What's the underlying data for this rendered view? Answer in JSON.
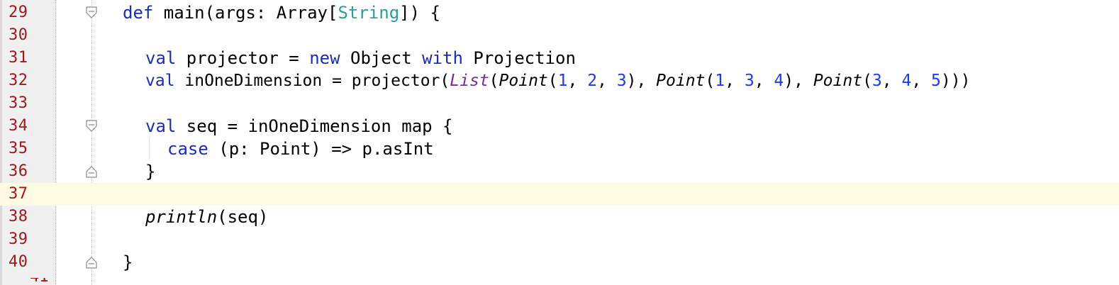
{
  "editor": {
    "current_line_number": "37",
    "lines": [
      {
        "number": "29",
        "text": "def main(args: Array[String]) {"
      },
      {
        "number": "30",
        "text": ""
      },
      {
        "number": "31",
        "text": "val projector = new Object with Projection"
      },
      {
        "number": "32",
        "text": "val inOneDimension = projector(List(Point(1, 2, 3), Point(1, 3, 4), Point(3, 4, 5)))"
      },
      {
        "number": "33",
        "text": ""
      },
      {
        "number": "34",
        "text": "val seq = inOneDimension map {"
      },
      {
        "number": "35",
        "text": "case (p: Point) => p.asInt"
      },
      {
        "number": "36",
        "text": "}"
      },
      {
        "number": "37",
        "text": ""
      },
      {
        "number": "38",
        "text": "println(seq)"
      },
      {
        "number": "39",
        "text": ""
      },
      {
        "number": "40",
        "text": "}"
      }
    ],
    "tokens": {
      "l29": {
        "def": "def",
        "main": " main(args: Array[",
        "String": "String",
        "end": "]) {"
      },
      "l31": {
        "val": "val",
        "a": " projector = ",
        "new": "new",
        "b": " Object ",
        "with": "with",
        "c": " Projection"
      },
      "l32": {
        "val": "val",
        "a": " inOneDimension = projector(",
        "List": "List",
        "p0": "(",
        "Point1": "Point",
        "p1": "(",
        "n1": "1",
        "c1": ", ",
        "n2": "2",
        "c2": ", ",
        "n3": "3",
        "p2": "), ",
        "Point2": "Point",
        "p3": "(",
        "n4": "1",
        "c3": ", ",
        "n5": "3",
        "c4": ", ",
        "n6": "4",
        "p4": "), ",
        "Point3": "Point",
        "p5": "(",
        "n7": "3",
        "c5": ", ",
        "n8": "4",
        "c6": ", ",
        "n9": "5",
        "p6": ")))"
      },
      "l34": {
        "val": "val",
        "a": " seq = inOneDimension map {"
      },
      "l35": {
        "case": "case",
        "a": " (p: Point) => p.asInt"
      },
      "l36": {
        "a": "}"
      },
      "l38": {
        "println": "println",
        "a": "(seq)"
      },
      "l40": {
        "a": "}"
      }
    },
    "next_line_number_partial": "41"
  },
  "colors": {
    "keyword": "#1a2fb0",
    "type": "#2a9d9d",
    "number": "#1a3cf0",
    "line_number": "#a01818",
    "current_line_bg": "#fffae3",
    "collection_call": "#7a2a9a"
  },
  "icons": {
    "fold_open": "fold-open-icon",
    "fold_close": "fold-close-icon"
  }
}
